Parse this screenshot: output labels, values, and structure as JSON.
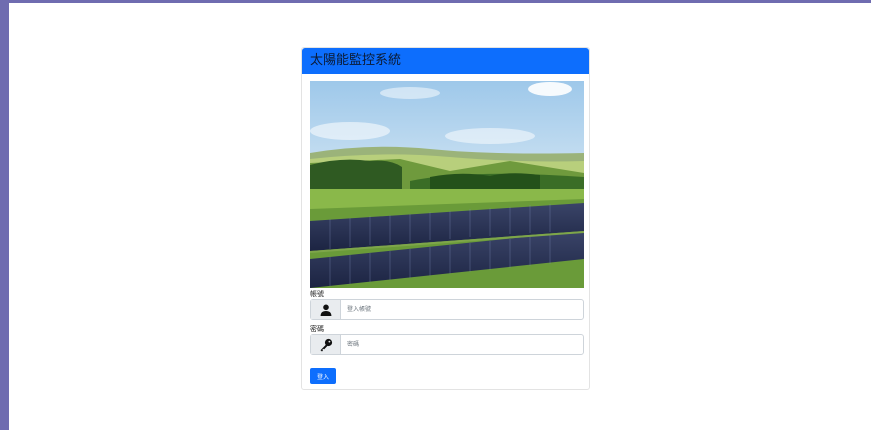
{
  "header": {
    "title": "太陽能監控系統"
  },
  "login": {
    "username_label": "帳號",
    "username_placeholder": "登入帳號",
    "username_value": "",
    "password_label": "密碼",
    "password_placeholder": "密碼",
    "password_value": "",
    "submit_label": "登入"
  },
  "icons": {
    "username_icon": "user-icon",
    "password_icon": "key-icon"
  },
  "colors": {
    "accent": "#0d6efd",
    "frame": "#6f6cb0"
  }
}
